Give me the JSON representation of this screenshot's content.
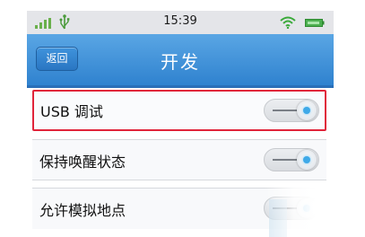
{
  "status_bar": {
    "time": "15:39",
    "icons": [
      "signal-icon",
      "usb-icon",
      "wifi-icon",
      "battery-icon"
    ],
    "signal_color": "#6ab04c",
    "battery_color": "#4caf50"
  },
  "header": {
    "back_label": "返回",
    "title": "开发",
    "color": "#3a8fd9"
  },
  "settings": {
    "items": [
      {
        "label": "USB 调试",
        "enabled": true,
        "highlighted": true
      },
      {
        "label": "保持唤醒状态",
        "enabled": true,
        "highlighted": false
      },
      {
        "label": "允许模拟地点",
        "enabled": true,
        "highlighted": false
      }
    ]
  },
  "colors": {
    "highlight_border": "#e0243a",
    "toggle_dot": "#3ea9e8"
  }
}
